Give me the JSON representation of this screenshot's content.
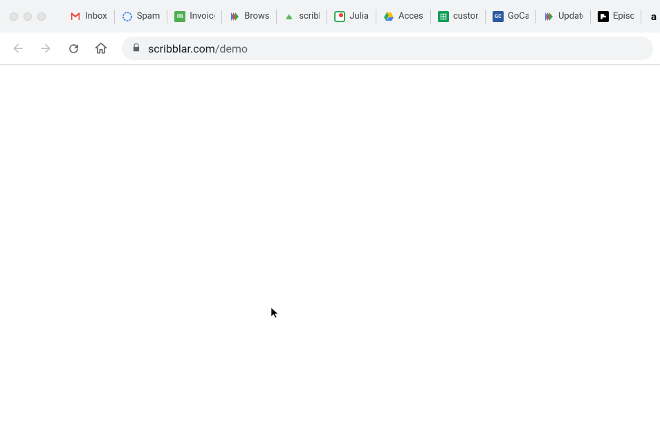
{
  "bookmarks": [
    {
      "label": "Inbox",
      "icon": "gmail"
    },
    {
      "label": "Spam",
      "icon": "octo"
    },
    {
      "label": "Invoice",
      "icon": "mgreen"
    },
    {
      "label": "Browse",
      "icon": "multiarrow"
    },
    {
      "label": "scribblar",
      "icon": "scrib"
    },
    {
      "label": "Julia",
      "icon": "julia"
    },
    {
      "label": "Access",
      "icon": "gdrive"
    },
    {
      "label": "customers",
      "icon": "gsheets"
    },
    {
      "label": "GoCardless",
      "icon": "gc"
    },
    {
      "label": "Updates",
      "icon": "multiarrow"
    },
    {
      "label": "Episodes",
      "icon": "flip"
    },
    {
      "label": "amazon",
      "icon": "amazon"
    }
  ],
  "url": {
    "host": "scribblar.com",
    "path": "/demo"
  }
}
